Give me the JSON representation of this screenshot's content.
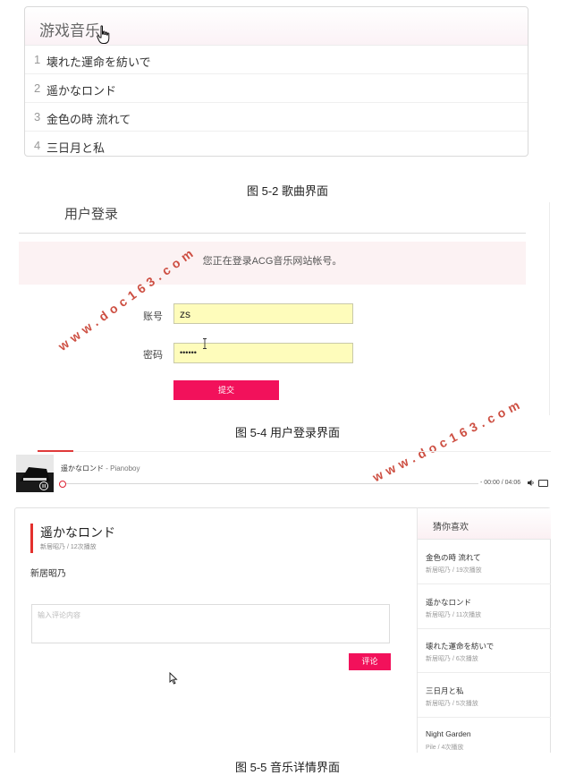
{
  "song_section": {
    "title": "游戏音乐",
    "songs": [
      {
        "num": "1",
        "name": "壊れた運命を紡いで"
      },
      {
        "num": "2",
        "name": "遥かなロンド"
      },
      {
        "num": "3",
        "name": "金色の時 流れて"
      },
      {
        "num": "4",
        "name": "三日月と私"
      }
    ],
    "caption": "图 5-2 歌曲界面"
  },
  "login_section": {
    "title": "用户登录",
    "notice": "您正在登录ACG音乐网站帐号。",
    "account_label": "账号",
    "account_value": "zs",
    "password_label": "密码",
    "password_value": "••••••",
    "submit_label": "提交",
    "caption": "图 5-4 用户登录界面"
  },
  "watermarks": {
    "text": "www.doc163.com"
  },
  "player": {
    "track_title": "遥かなロンド",
    "track_artist": " - Pianoboy",
    "time": "- 00:00 / 04:06"
  },
  "detail_section": {
    "title": "遥かなロンド",
    "meta": "新居昭乃 / 12次播放",
    "artist": "新居昭乃",
    "comment_placeholder": "输入评论内容",
    "comment_button": "评论",
    "recommend_title": "猜你喜欢",
    "recommendations": [
      {
        "name": "金色の時 流れて",
        "meta": "新居昭乃 / 19次播放"
      },
      {
        "name": "遥かなロンド",
        "meta": "新居昭乃 / 11次播放"
      },
      {
        "name": "壊れた運命を紡いで",
        "meta": "新居昭乃 / 6次播放"
      },
      {
        "name": "三日月と私",
        "meta": "新居昭乃 / 5次播放"
      },
      {
        "name": "Night Garden",
        "meta": "Pile / 4次播放"
      }
    ],
    "caption": "图 5-5 音乐详情界面"
  },
  "colors": {
    "accent_pink": "#f2115b",
    "notice_bg": "#fcf2f3",
    "input_bg": "#fefcbb",
    "watermark": "#c83c2e"
  }
}
